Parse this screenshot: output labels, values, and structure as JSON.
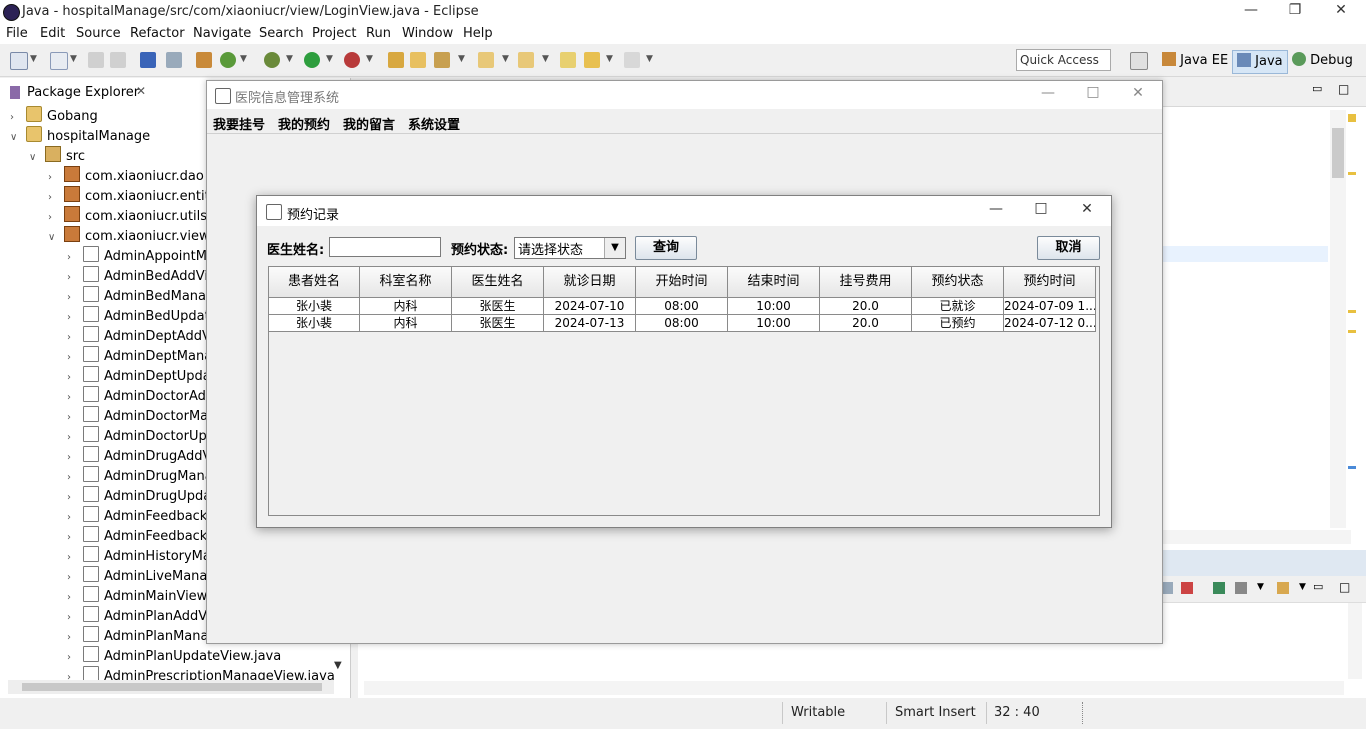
{
  "eclipse": {
    "window_title": "Java - hospitalManage/src/com/xiaoniucr/view/LoginView.java - Eclipse",
    "menu": [
      "File",
      "Edit",
      "Source",
      "Refactor",
      "Navigate",
      "Search",
      "Project",
      "Run",
      "Window",
      "Help"
    ],
    "quick_access": "Quick Access",
    "perspectives": [
      "Java EE",
      "Java",
      "Debug"
    ],
    "package_explorer": {
      "tab_label": "Package Explorer",
      "tree": [
        {
          "label": "Gobang",
          "indent": 0,
          "twisty": ">",
          "icon": "project"
        },
        {
          "label": "hospitalManage",
          "indent": 0,
          "twisty": "v",
          "icon": "project"
        },
        {
          "label": "src",
          "indent": 1,
          "twisty": "v",
          "icon": "src"
        },
        {
          "label": "com.xiaoniucr.dao",
          "indent": 2,
          "twisty": ">",
          "icon": "package"
        },
        {
          "label": "com.xiaoniucr.entity",
          "indent": 2,
          "twisty": ">",
          "icon": "package"
        },
        {
          "label": "com.xiaoniucr.utils",
          "indent": 2,
          "twisty": ">",
          "icon": "package"
        },
        {
          "label": "com.xiaoniucr.view",
          "indent": 2,
          "twisty": "v",
          "icon": "package"
        },
        {
          "label": "AdminAppointMa",
          "indent": 3,
          "twisty": ">",
          "icon": "java"
        },
        {
          "label": "AdminBedAddVie",
          "indent": 3,
          "twisty": ">",
          "icon": "java"
        },
        {
          "label": "AdminBedManag",
          "indent": 3,
          "twisty": ">",
          "icon": "java"
        },
        {
          "label": "AdminBedUpdate",
          "indent": 3,
          "twisty": ">",
          "icon": "java"
        },
        {
          "label": "AdminDeptAddVi",
          "indent": 3,
          "twisty": ">",
          "icon": "java"
        },
        {
          "label": "AdminDeptManag",
          "indent": 3,
          "twisty": ">",
          "icon": "java"
        },
        {
          "label": "AdminDeptUpdat",
          "indent": 3,
          "twisty": ">",
          "icon": "java"
        },
        {
          "label": "AdminDoctorAdd",
          "indent": 3,
          "twisty": ">",
          "icon": "java"
        },
        {
          "label": "AdminDoctorMar",
          "indent": 3,
          "twisty": ">",
          "icon": "java"
        },
        {
          "label": "AdminDoctorUpd",
          "indent": 3,
          "twisty": ">",
          "icon": "java"
        },
        {
          "label": "AdminDrugAddVi",
          "indent": 3,
          "twisty": ">",
          "icon": "java"
        },
        {
          "label": "AdminDrugMana",
          "indent": 3,
          "twisty": ">",
          "icon": "java"
        },
        {
          "label": "AdminDrugUpdat",
          "indent": 3,
          "twisty": ">",
          "icon": "java"
        },
        {
          "label": "AdminFeedbackN",
          "indent": 3,
          "twisty": ">",
          "icon": "java"
        },
        {
          "label": "AdminFeedbackR",
          "indent": 3,
          "twisty": ">",
          "icon": "java"
        },
        {
          "label": "AdminHistoryMar",
          "indent": 3,
          "twisty": ">",
          "icon": "java"
        },
        {
          "label": "AdminLiveManag",
          "indent": 3,
          "twisty": ">",
          "icon": "java"
        },
        {
          "label": "AdminMainView.j",
          "indent": 3,
          "twisty": ">",
          "icon": "java"
        },
        {
          "label": "AdminPlanAddVie",
          "indent": 3,
          "twisty": ">",
          "icon": "java"
        },
        {
          "label": "AdminPlanManag",
          "indent": 3,
          "twisty": ">",
          "icon": "java"
        },
        {
          "label": "AdminPlanUpdateView.java",
          "indent": 3,
          "twisty": ">",
          "icon": "java"
        },
        {
          "label": "AdminPrescriptionManageView.java",
          "indent": 3,
          "twisty": ">",
          "icon": "java"
        }
      ]
    },
    "status": {
      "writable": "Writable",
      "insert_mode": "Smart Insert",
      "position": "32 : 40"
    }
  },
  "main_window": {
    "title": "医院信息管理系统",
    "menu": [
      "我要挂号",
      "我的预约",
      "我的留言",
      "系统设置"
    ]
  },
  "dialog": {
    "title": "预约记录",
    "doctor_label": "医生姓名:",
    "doctor_value": "",
    "status_label": "预约状态:",
    "status_selected": "请选择状态",
    "query_button": "查询",
    "cancel_button": "取消",
    "table": {
      "columns": [
        "患者姓名",
        "科室名称",
        "医生姓名",
        "就诊日期",
        "开始时间",
        "结束时间",
        "挂号费用",
        "预约状态",
        "预约时间"
      ],
      "rows": [
        [
          "张小裴",
          "内科",
          "张医生",
          "2024-07-10",
          "08:00",
          "10:00",
          "20.0",
          "已就诊",
          "2024-07-09 1..."
        ],
        [
          "张小裴",
          "内科",
          "张医生",
          "2024-07-13",
          "08:00",
          "10:00",
          "20.0",
          "已预约",
          "2024-07-12 0..."
        ]
      ]
    }
  }
}
